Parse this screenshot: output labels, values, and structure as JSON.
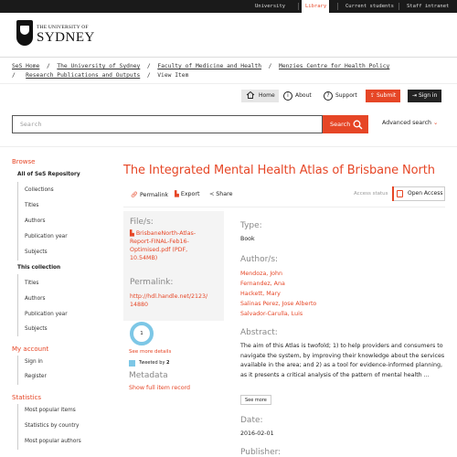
{
  "topnav": {
    "university": "University",
    "library": "Library",
    "current_students": "Current students",
    "staff_intranet": "Staff intranet"
  },
  "logo": {
    "line1": "THE UNIVERSITY OF",
    "line2": "SYDNEY"
  },
  "breadcrumb": {
    "items": [
      "SeS Home",
      "The University of Sydney",
      "Faculty of Medicine and Health",
      "Menzies Centre for Health Policy",
      "Research Publications and Outputs"
    ],
    "current": "View Item",
    "sep": "/"
  },
  "actions": {
    "home": "Home",
    "about": "About",
    "support": "Support",
    "submit": "Submit",
    "signin": "Sign in"
  },
  "search": {
    "placeholder": "Search",
    "button": "Search",
    "advanced": "Advanced search"
  },
  "sidebar": {
    "browse": "Browse",
    "all_repo": "All of SeS Repository",
    "all_items": [
      "Collections",
      "Titles",
      "Authors",
      "Publication year",
      "Subjects"
    ],
    "this_collection": "This collection",
    "coll_items": [
      "Titles",
      "Authors",
      "Publication year",
      "Subjects"
    ],
    "my_account": "My account",
    "account_items": [
      "Sign in",
      "Register"
    ],
    "statistics": "Statistics",
    "stats_items": [
      "Most popular items",
      "Statistics by country",
      "Most popular authors"
    ]
  },
  "item": {
    "title": "The Integrated Mental Health Atlas of Brisbane North",
    "permalink_btn": "Permalink",
    "export_btn": "Export",
    "share_btn": "Share",
    "access_label": "Access status",
    "access_value": "Open Access",
    "files_label": "File/s:",
    "file_name_1": "BrisbaneNorth-Atlas-",
    "file_name_2": "Report-FINAL-Feb16-",
    "file_name_3": "Optimised.pdf (PDF,",
    "file_name_4": "10.54MB)",
    "permalink_label": "Permalink:",
    "permalink_1": "http://hdl.handle.net/2123/",
    "permalink_2": "14880",
    "altmetric_score": "1",
    "see_more_details": "See more details",
    "tweeted_by": "Tweeted by",
    "tweet_count": "2",
    "metadata_label": "Metadata",
    "full_record": "Show full item record",
    "type_label": "Type:",
    "type_value": "Book",
    "authors_label": "Author/s:",
    "authors": [
      "Mendoza, John",
      "Fernandez, Ana",
      "Hackett, Mary",
      "Salinas Perez, Jose Alberto",
      "Salvador-Carulla, Luis"
    ],
    "abstract_label": "Abstract:",
    "abstract_text": "The aim of this Atlas is twofold; 1) to help providers and consumers to navigate the system, by improving their knowledge about the services available in the area; and 2) as a tool for evidence-informed planning, as it presents a critical analysis of the pattern of mental health ...",
    "see_more": "See more",
    "date_label": "Date:",
    "date_value": "2016-02-01",
    "publisher_label": "Publisher:"
  },
  "colors": {
    "accent": "#e64626",
    "dark": "#1a1a1a",
    "altmetric": "#7dc7e6"
  }
}
